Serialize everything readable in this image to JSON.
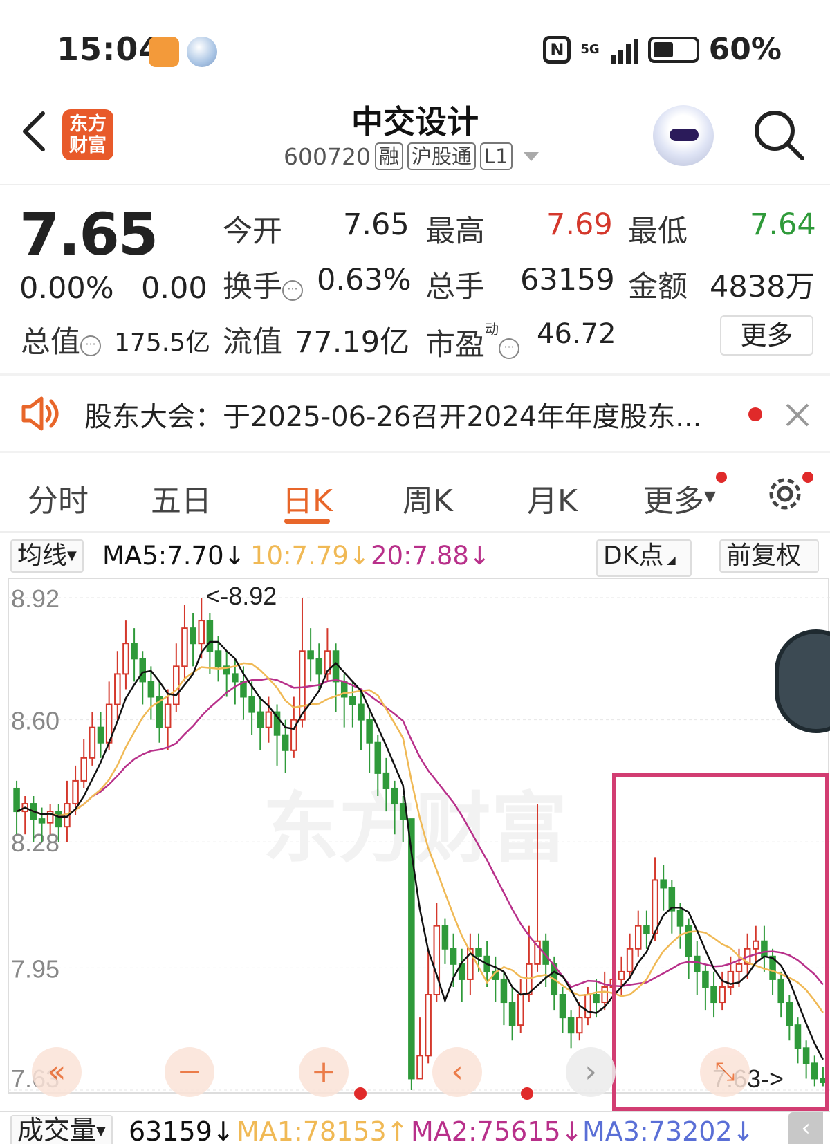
{
  "status_bar": {
    "time": "15:04",
    "battery": "60%",
    "network": "5G"
  },
  "header": {
    "title": "中交设计",
    "code": "600720",
    "tags": [
      "融",
      "沪股通",
      "L1"
    ],
    "logo_text": [
      "东方",
      "财富"
    ]
  },
  "quote": {
    "price": "7.65",
    "change_pct": "0.00%",
    "change": "0.00",
    "open_label": "今开",
    "open": "7.65",
    "high_label": "最高",
    "high": "7.69",
    "low_label": "最低",
    "low": "7.64",
    "turnover_label": "换手",
    "turnover": "0.63%",
    "volume_label": "总手",
    "volume": "63159",
    "amount_label": "金额",
    "amount": "4838万",
    "mktcap_label": "总值",
    "mktcap": "175.5亿",
    "float_label": "流值",
    "float_cap": "77.19亿",
    "pe_label": "市盈",
    "pe_sup": "动",
    "pe": "46.72",
    "more": "更多"
  },
  "notice": {
    "text": "股东大会：于2025-06-26召开2024年年度股东..."
  },
  "tabs": [
    "分时",
    "五日",
    "日K",
    "周K",
    "月K",
    "更多"
  ],
  "active_tab": "日K",
  "ma_bar": {
    "selector": "均线",
    "ma5": "MA5:7.70↓",
    "ma10": "10:7.79↓",
    "ma20": "20:7.88↓",
    "dk": "DK点",
    "adjust": "前复权"
  },
  "colors": {
    "accent": "#e8662a",
    "up": "#d4382c",
    "down": "#2f9a3a",
    "ma5": "#111111",
    "ma10": "#f0b955",
    "ma20": "#b8308a",
    "highlight": "#d23d72"
  },
  "chart_data": {
    "type": "candlestick",
    "y_ticks": [
      "8.92",
      "8.60",
      "8.28",
      "7.95",
      "7.63"
    ],
    "ylim": [
      7.63,
      8.92
    ],
    "max_label": "<-8.92",
    "last_label": "7.63->",
    "watermark": "东方财富",
    "candles": [
      [
        8.42,
        8.36,
        8.44,
        8.3
      ],
      [
        8.36,
        8.38,
        8.4,
        8.3
      ],
      [
        8.38,
        8.34,
        8.4,
        8.28
      ],
      [
        8.34,
        8.33,
        8.37,
        8.28
      ],
      [
        8.33,
        8.36,
        8.38,
        8.3
      ],
      [
        8.36,
        8.32,
        8.38,
        8.28
      ],
      [
        8.32,
        8.38,
        8.44,
        8.28
      ],
      [
        8.38,
        8.44,
        8.48,
        8.35
      ],
      [
        8.44,
        8.5,
        8.55,
        8.42
      ],
      [
        8.5,
        8.58,
        8.62,
        8.48
      ],
      [
        8.58,
        8.54,
        8.62,
        8.5
      ],
      [
        8.54,
        8.64,
        8.7,
        8.52
      ],
      [
        8.64,
        8.72,
        8.78,
        8.6
      ],
      [
        8.72,
        8.8,
        8.86,
        8.68
      ],
      [
        8.8,
        8.76,
        8.84,
        8.7
      ],
      [
        8.76,
        8.7,
        8.78,
        8.64
      ],
      [
        8.7,
        8.66,
        8.74,
        8.6
      ],
      [
        8.66,
        8.58,
        8.7,
        8.54
      ],
      [
        8.58,
        8.64,
        8.68,
        8.52
      ],
      [
        8.64,
        8.74,
        8.8,
        8.62
      ],
      [
        8.74,
        8.84,
        8.9,
        8.7
      ],
      [
        8.84,
        8.8,
        8.88,
        8.74
      ],
      [
        8.8,
        8.86,
        8.92,
        8.76
      ],
      [
        8.86,
        8.78,
        8.88,
        8.72
      ],
      [
        8.78,
        8.74,
        8.82,
        8.7
      ],
      [
        8.74,
        8.72,
        8.78,
        8.66
      ],
      [
        8.72,
        8.7,
        8.76,
        8.64
      ],
      [
        8.7,
        8.66,
        8.74,
        8.6
      ],
      [
        8.66,
        8.62,
        8.7,
        8.56
      ],
      [
        8.62,
        8.58,
        8.66,
        8.52
      ],
      [
        8.58,
        8.62,
        8.66,
        8.54
      ],
      [
        8.62,
        8.56,
        8.64,
        8.48
      ],
      [
        8.56,
        8.52,
        8.6,
        8.46
      ],
      [
        8.52,
        8.6,
        8.66,
        8.5
      ],
      [
        8.6,
        8.78,
        8.92,
        8.58
      ],
      [
        8.78,
        8.76,
        8.84,
        8.7
      ],
      [
        8.76,
        8.72,
        8.8,
        8.68
      ],
      [
        8.72,
        8.78,
        8.84,
        8.7
      ],
      [
        8.78,
        8.7,
        8.8,
        8.62
      ],
      [
        8.7,
        8.66,
        8.72,
        8.58
      ],
      [
        8.66,
        8.64,
        8.7,
        8.58
      ],
      [
        8.64,
        8.6,
        8.68,
        8.52
      ],
      [
        8.6,
        8.54,
        8.62,
        8.46
      ],
      [
        8.54,
        8.46,
        8.56,
        8.4
      ],
      [
        8.46,
        8.42,
        8.5,
        8.36
      ],
      [
        8.42,
        8.38,
        8.44,
        8.3
      ],
      [
        8.38,
        8.34,
        8.4,
        8.28
      ],
      [
        8.34,
        7.66,
        8.34,
        7.63
      ],
      [
        7.66,
        7.72,
        7.82,
        7.66
      ],
      [
        7.72,
        7.88,
        8.0,
        7.7
      ],
      [
        7.88,
        8.06,
        8.12,
        7.86
      ],
      [
        8.06,
        8.0,
        8.08,
        7.96
      ],
      [
        8.0,
        7.96,
        8.04,
        7.9
      ],
      [
        7.96,
        7.92,
        8.0,
        7.86
      ],
      [
        7.92,
        8.0,
        8.04,
        7.88
      ],
      [
        8.0,
        7.98,
        8.04,
        7.94
      ],
      [
        7.98,
        7.94,
        8.02,
        7.9
      ],
      [
        7.94,
        7.92,
        7.98,
        7.86
      ],
      [
        7.92,
        7.86,
        7.94,
        7.8
      ],
      [
        7.86,
        7.8,
        7.9,
        7.76
      ],
      [
        7.8,
        7.88,
        7.92,
        7.78
      ],
      [
        7.88,
        7.96,
        8.06,
        7.86
      ],
      [
        7.96,
        8.02,
        8.38,
        7.94
      ],
      [
        8.02,
        7.96,
        8.04,
        7.9
      ],
      [
        7.96,
        7.88,
        7.98,
        7.84
      ],
      [
        7.88,
        7.82,
        7.9,
        7.78
      ],
      [
        7.82,
        7.78,
        7.84,
        7.74
      ],
      [
        7.78,
        7.82,
        7.86,
        7.76
      ],
      [
        7.82,
        7.88,
        7.9,
        7.8
      ],
      [
        7.88,
        7.86,
        7.92,
        7.82
      ],
      [
        7.86,
        7.9,
        7.94,
        7.84
      ],
      [
        7.9,
        7.92,
        7.96,
        7.86
      ],
      [
        7.92,
        7.94,
        7.98,
        7.88
      ],
      [
        7.94,
        8.0,
        8.04,
        7.92
      ],
      [
        8.0,
        8.06,
        8.1,
        7.98
      ],
      [
        8.06,
        8.04,
        8.1,
        8.0
      ],
      [
        8.04,
        8.18,
        8.24,
        8.02
      ],
      [
        8.18,
        8.16,
        8.22,
        8.1
      ],
      [
        8.16,
        8.1,
        8.18,
        8.04
      ],
      [
        8.1,
        8.06,
        8.12,
        8.0
      ],
      [
        8.06,
        7.98,
        8.08,
        7.92
      ],
      [
        7.98,
        7.94,
        8.02,
        7.88
      ],
      [
        7.94,
        7.9,
        7.96,
        7.84
      ],
      [
        7.9,
        7.86,
        7.94,
        7.82
      ],
      [
        7.86,
        7.9,
        7.94,
        7.84
      ],
      [
        7.9,
        7.94,
        7.98,
        7.88
      ],
      [
        7.94,
        7.96,
        8.0,
        7.9
      ],
      [
        7.96,
        8.0,
        8.04,
        7.92
      ],
      [
        8.0,
        8.02,
        8.06,
        7.96
      ],
      [
        8.02,
        7.98,
        8.06,
        7.94
      ],
      [
        7.98,
        7.92,
        8.0,
        7.88
      ],
      [
        7.92,
        7.86,
        7.94,
        7.82
      ],
      [
        7.86,
        7.8,
        7.88,
        7.76
      ],
      [
        7.8,
        7.74,
        7.82,
        7.7
      ],
      [
        7.74,
        7.7,
        7.76,
        7.66
      ],
      [
        7.7,
        7.66,
        7.72,
        7.64
      ],
      [
        7.66,
        7.65,
        7.69,
        7.64
      ]
    ],
    "ma_lines": {
      "ma5_color": "#111111",
      "ma10_color": "#f0b955",
      "ma20_color": "#b8308a"
    },
    "controls": [
      "«",
      "−",
      "+",
      "‹",
      "›",
      "⤡"
    ]
  },
  "volume_bar": {
    "selector": "成交量",
    "vol": "63159↓",
    "ma1": "MA1:78153↑",
    "ma2": "MA2:75615↓",
    "ma3": "MA3:73202↓"
  }
}
